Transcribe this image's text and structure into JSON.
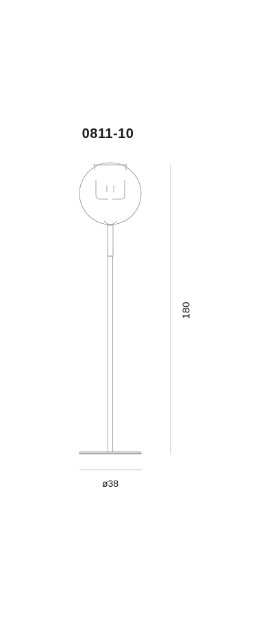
{
  "model": {
    "code": "0811-10"
  },
  "dimensions": {
    "height": "180",
    "diameter": "ø38"
  },
  "colors": {
    "text": "#1a1a1a",
    "line": "#8c8c8c",
    "dimension_line": "#b0b0b0"
  }
}
